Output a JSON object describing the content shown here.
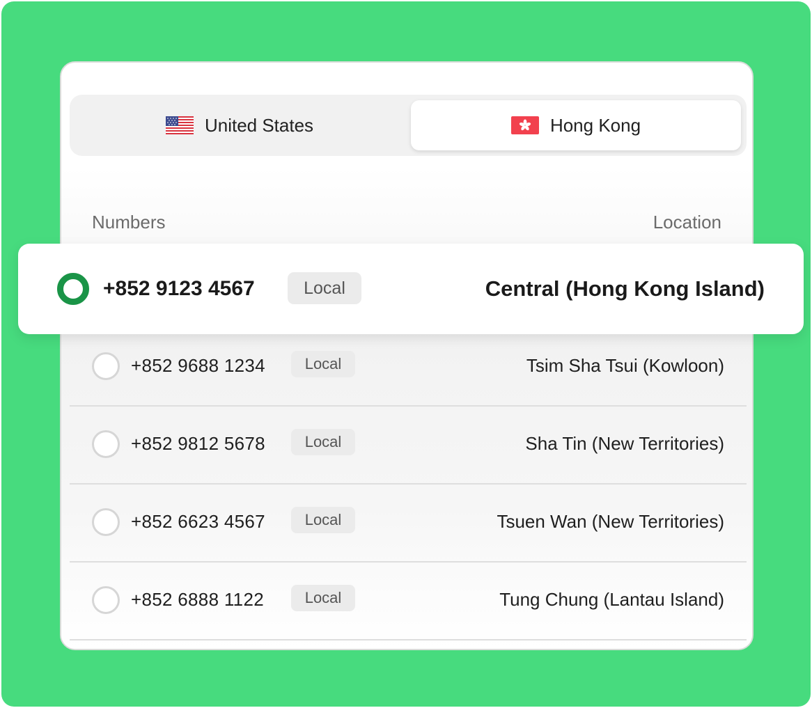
{
  "tabs": [
    {
      "label": "United States",
      "flag": "us-flag-icon",
      "selected": false
    },
    {
      "label": "Hong Kong",
      "flag": "hk-flag-icon",
      "selected": true
    }
  ],
  "columns": {
    "numbers": "Numbers",
    "location": "Location"
  },
  "selected_row": {
    "number": "+852 9123 4567",
    "badge": "Local",
    "location": "Central (Hong Kong Island)"
  },
  "rows": [
    {
      "number": "+852 9688 1234",
      "badge": "Local",
      "location": "Tsim Sha Tsui (Kowloon)"
    },
    {
      "number": "+852 9812 5678",
      "badge": "Local",
      "location": "Sha Tin (New Territories)"
    },
    {
      "number": "+852 6623 4567",
      "badge": "Local",
      "location": "Tsuen Wan (New Territories)"
    },
    {
      "number": "+852 6888 1122",
      "badge": "Local",
      "location": "Tung Chung (Lantau Island)"
    }
  ],
  "colors": {
    "background": "#47db7e",
    "selected_radio": "#1a9447"
  }
}
